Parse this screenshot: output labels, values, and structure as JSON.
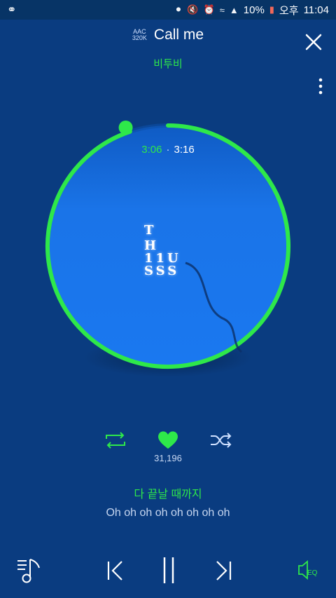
{
  "status": {
    "battery": "10%",
    "am_pm": "오후",
    "clock": "11:04"
  },
  "track": {
    "codec_line1": "AAC",
    "codec_line2": "320K",
    "title": "Call me",
    "artist": "비투비"
  },
  "time": {
    "current": "3:06",
    "separator": "·",
    "total": "3:16",
    "progress": 0.949
  },
  "art": {
    "line1": "T",
    "line2": "H",
    "line3": "11U",
    "line4": "SSS"
  },
  "likes": "31,196",
  "lyrics": {
    "current": "다 끝날 때까지",
    "next": "Oh oh oh oh oh oh oh oh"
  },
  "bottom": {
    "eq_label": "EQ"
  },
  "colors": {
    "accent": "#2ee84a",
    "background": "#0a3c80",
    "disc": "#1a74e8"
  }
}
